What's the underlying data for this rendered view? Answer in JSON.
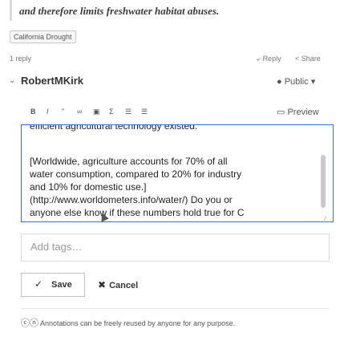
{
  "quote": {
    "text": "and therefore limits freshwater habitat abuses."
  },
  "tags": [
    "California Drought"
  ],
  "replies": {
    "count_label": "1 reply",
    "reply_label": "Reply",
    "share_label": "Share"
  },
  "author": {
    "name": "RobertMKirk",
    "privacy_label": "Public"
  },
  "toolbar": {
    "items": [
      "B",
      "I",
      "”",
      "∞",
      "▣",
      "Σ",
      "☰",
      "☰"
    ],
    "preview_label": "Preview"
  },
  "editor": {
    "prev_line": "efficient agricultural technology existed.",
    "lines": [
      "[Worldwide, agriculture accounts for 70% of all",
      "water consumption, compared to 20% for industry",
      "and 10% for domestic use.]",
      "(http://www.worldometers.info/water/) Do you or",
      "anyone else know if these numbers hold true for C"
    ]
  },
  "tags_input": {
    "placeholder": "Add tags…"
  },
  "actions": {
    "save_label": "Save",
    "cancel_label": "Cancel"
  },
  "license": {
    "text": "Annotations can be freely reused by anyone for any purpose."
  }
}
